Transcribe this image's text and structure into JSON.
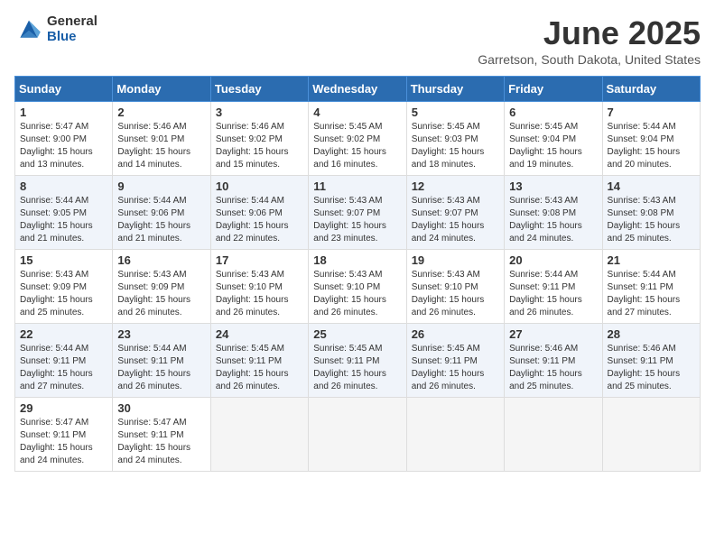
{
  "logo": {
    "general": "General",
    "blue": "Blue"
  },
  "title": "June 2025",
  "subtitle": "Garretson, South Dakota, United States",
  "headers": [
    "Sunday",
    "Monday",
    "Tuesday",
    "Wednesday",
    "Thursday",
    "Friday",
    "Saturday"
  ],
  "weeks": [
    [
      {
        "day": "1",
        "sunrise": "Sunrise: 5:47 AM",
        "sunset": "Sunset: 9:00 PM",
        "daylight": "Daylight: 15 hours and 13 minutes."
      },
      {
        "day": "2",
        "sunrise": "Sunrise: 5:46 AM",
        "sunset": "Sunset: 9:01 PM",
        "daylight": "Daylight: 15 hours and 14 minutes."
      },
      {
        "day": "3",
        "sunrise": "Sunrise: 5:46 AM",
        "sunset": "Sunset: 9:02 PM",
        "daylight": "Daylight: 15 hours and 15 minutes."
      },
      {
        "day": "4",
        "sunrise": "Sunrise: 5:45 AM",
        "sunset": "Sunset: 9:02 PM",
        "daylight": "Daylight: 15 hours and 16 minutes."
      },
      {
        "day": "5",
        "sunrise": "Sunrise: 5:45 AM",
        "sunset": "Sunset: 9:03 PM",
        "daylight": "Daylight: 15 hours and 18 minutes."
      },
      {
        "day": "6",
        "sunrise": "Sunrise: 5:45 AM",
        "sunset": "Sunset: 9:04 PM",
        "daylight": "Daylight: 15 hours and 19 minutes."
      },
      {
        "day": "7",
        "sunrise": "Sunrise: 5:44 AM",
        "sunset": "Sunset: 9:04 PM",
        "daylight": "Daylight: 15 hours and 20 minutes."
      }
    ],
    [
      {
        "day": "8",
        "sunrise": "Sunrise: 5:44 AM",
        "sunset": "Sunset: 9:05 PM",
        "daylight": "Daylight: 15 hours and 21 minutes."
      },
      {
        "day": "9",
        "sunrise": "Sunrise: 5:44 AM",
        "sunset": "Sunset: 9:06 PM",
        "daylight": "Daylight: 15 hours and 21 minutes."
      },
      {
        "day": "10",
        "sunrise": "Sunrise: 5:44 AM",
        "sunset": "Sunset: 9:06 PM",
        "daylight": "Daylight: 15 hours and 22 minutes."
      },
      {
        "day": "11",
        "sunrise": "Sunrise: 5:43 AM",
        "sunset": "Sunset: 9:07 PM",
        "daylight": "Daylight: 15 hours and 23 minutes."
      },
      {
        "day": "12",
        "sunrise": "Sunrise: 5:43 AM",
        "sunset": "Sunset: 9:07 PM",
        "daylight": "Daylight: 15 hours and 24 minutes."
      },
      {
        "day": "13",
        "sunrise": "Sunrise: 5:43 AM",
        "sunset": "Sunset: 9:08 PM",
        "daylight": "Daylight: 15 hours and 24 minutes."
      },
      {
        "day": "14",
        "sunrise": "Sunrise: 5:43 AM",
        "sunset": "Sunset: 9:08 PM",
        "daylight": "Daylight: 15 hours and 25 minutes."
      }
    ],
    [
      {
        "day": "15",
        "sunrise": "Sunrise: 5:43 AM",
        "sunset": "Sunset: 9:09 PM",
        "daylight": "Daylight: 15 hours and 25 minutes."
      },
      {
        "day": "16",
        "sunrise": "Sunrise: 5:43 AM",
        "sunset": "Sunset: 9:09 PM",
        "daylight": "Daylight: 15 hours and 26 minutes."
      },
      {
        "day": "17",
        "sunrise": "Sunrise: 5:43 AM",
        "sunset": "Sunset: 9:10 PM",
        "daylight": "Daylight: 15 hours and 26 minutes."
      },
      {
        "day": "18",
        "sunrise": "Sunrise: 5:43 AM",
        "sunset": "Sunset: 9:10 PM",
        "daylight": "Daylight: 15 hours and 26 minutes."
      },
      {
        "day": "19",
        "sunrise": "Sunrise: 5:43 AM",
        "sunset": "Sunset: 9:10 PM",
        "daylight": "Daylight: 15 hours and 26 minutes."
      },
      {
        "day": "20",
        "sunrise": "Sunrise: 5:44 AM",
        "sunset": "Sunset: 9:11 PM",
        "daylight": "Daylight: 15 hours and 26 minutes."
      },
      {
        "day": "21",
        "sunrise": "Sunrise: 5:44 AM",
        "sunset": "Sunset: 9:11 PM",
        "daylight": "Daylight: 15 hours and 27 minutes."
      }
    ],
    [
      {
        "day": "22",
        "sunrise": "Sunrise: 5:44 AM",
        "sunset": "Sunset: 9:11 PM",
        "daylight": "Daylight: 15 hours and 27 minutes."
      },
      {
        "day": "23",
        "sunrise": "Sunrise: 5:44 AM",
        "sunset": "Sunset: 9:11 PM",
        "daylight": "Daylight: 15 hours and 26 minutes."
      },
      {
        "day": "24",
        "sunrise": "Sunrise: 5:45 AM",
        "sunset": "Sunset: 9:11 PM",
        "daylight": "Daylight: 15 hours and 26 minutes."
      },
      {
        "day": "25",
        "sunrise": "Sunrise: 5:45 AM",
        "sunset": "Sunset: 9:11 PM",
        "daylight": "Daylight: 15 hours and 26 minutes."
      },
      {
        "day": "26",
        "sunrise": "Sunrise: 5:45 AM",
        "sunset": "Sunset: 9:11 PM",
        "daylight": "Daylight: 15 hours and 26 minutes."
      },
      {
        "day": "27",
        "sunrise": "Sunrise: 5:46 AM",
        "sunset": "Sunset: 9:11 PM",
        "daylight": "Daylight: 15 hours and 25 minutes."
      },
      {
        "day": "28",
        "sunrise": "Sunrise: 5:46 AM",
        "sunset": "Sunset: 9:11 PM",
        "daylight": "Daylight: 15 hours and 25 minutes."
      }
    ],
    [
      {
        "day": "29",
        "sunrise": "Sunrise: 5:47 AM",
        "sunset": "Sunset: 9:11 PM",
        "daylight": "Daylight: 15 hours and 24 minutes."
      },
      {
        "day": "30",
        "sunrise": "Sunrise: 5:47 AM",
        "sunset": "Sunset: 9:11 PM",
        "daylight": "Daylight: 15 hours and 24 minutes."
      },
      null,
      null,
      null,
      null,
      null
    ]
  ]
}
